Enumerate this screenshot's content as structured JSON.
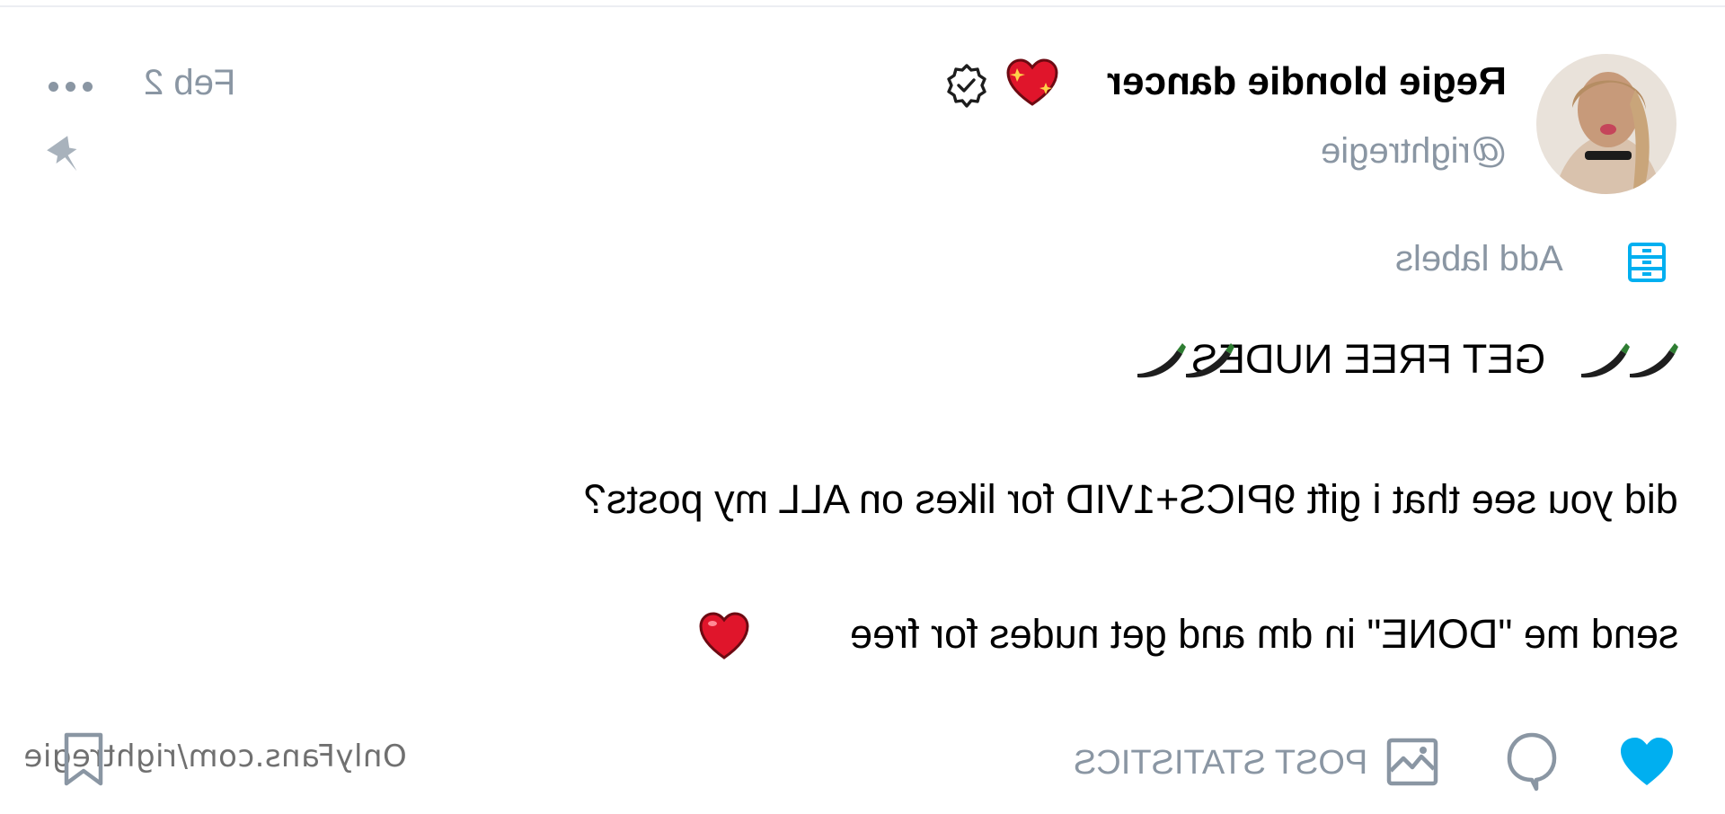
{
  "post": {
    "date": "Feb 2",
    "author": {
      "name": "Regie blondie dancer",
      "handle": "@rightregie",
      "verified": true
    },
    "labels_action": "Add labels",
    "body": {
      "line1": "GET FREE NUDES",
      "line2": "did you see that i gift 9PICS+1VID for likes on ALL my posts?",
      "line3": "send me \"DONE\" in dm and get nudes for free"
    },
    "footer": {
      "statistics_label": "POST STATISTICS"
    }
  },
  "watermark": "OnlyFans.com/rightregie",
  "icons": {
    "more": "more-icon",
    "pin": "pin-icon",
    "verified": "verified-badge-icon",
    "labels": "labels-icon",
    "like": "heart-icon",
    "comment": "comment-icon",
    "statistics": "image-stats-icon",
    "bookmark": "bookmark-icon"
  },
  "colors": {
    "accent": "#00aff0",
    "muted": "#8a96a3",
    "heart_red": "#e0152b"
  }
}
